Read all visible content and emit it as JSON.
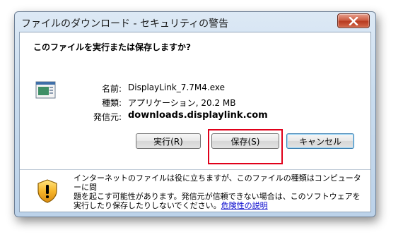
{
  "window": {
    "title": "ファイルのダウンロード - セキュリティの警告",
    "close_icon": "close-x-icon"
  },
  "dialog": {
    "question": "このファイルを実行または保存しますか?",
    "file_icon": "executable-file-icon",
    "name_label": "名前:",
    "name_value": "DisplayLink_7.7M4.exe",
    "type_label": "種類:",
    "type_value": "アプリケーション, 20.2 MB",
    "source_label": "発信元:",
    "source_value": "downloads.displaylink.com"
  },
  "buttons": {
    "run_label": "実行(R)",
    "save_label": "保存(S)",
    "cancel_label": "キャンセル"
  },
  "warning": {
    "icon": "security-shield-icon",
    "line1": "インターネットのファイルは役に立ちますが、このファイルの種類はコンピューターに問",
    "line2": "題を起こす可能性があります。発信元が信頼できない場合は、このソフトウェアを",
    "line3": "実行したり保存したりしないでください。",
    "link_text": "危険性の説明"
  },
  "colors": {
    "highlight": "#e0001a",
    "link": "#0000cc"
  }
}
